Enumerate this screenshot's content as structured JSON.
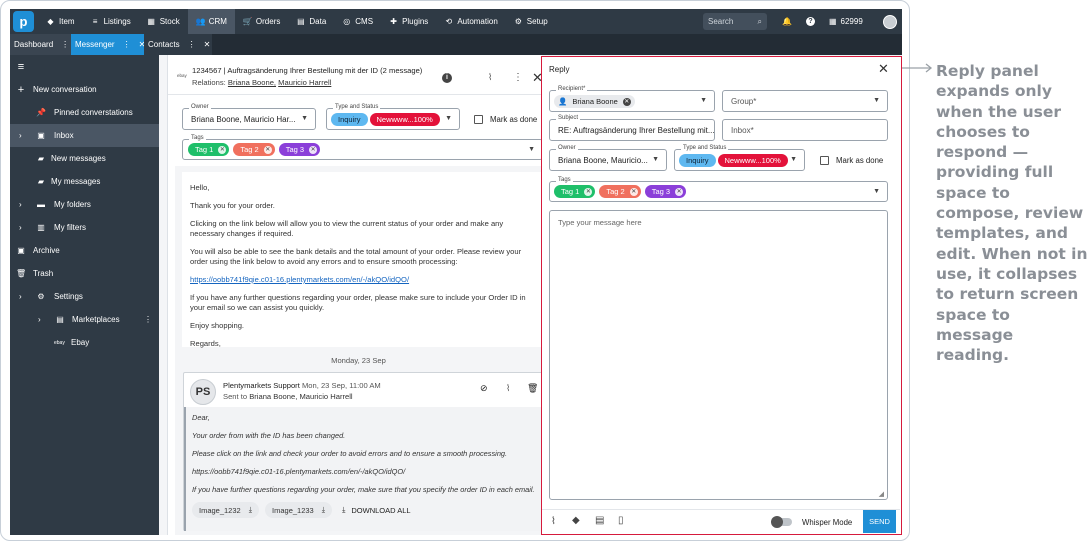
{
  "topbar": {
    "nav": [
      {
        "label": "Item",
        "icon": "tag-icon"
      },
      {
        "label": "Listings",
        "icon": "list-icon"
      },
      {
        "label": "Stock",
        "icon": "stock-icon"
      },
      {
        "label": "CRM",
        "icon": "people-icon"
      },
      {
        "label": "Orders",
        "icon": "cart-icon"
      },
      {
        "label": "Data",
        "icon": "data-icon"
      },
      {
        "label": "CMS",
        "icon": "cms-icon"
      },
      {
        "label": "Plugins",
        "icon": "puzzle-icon"
      },
      {
        "label": "Automation",
        "icon": "automation-icon"
      },
      {
        "label": "Setup",
        "icon": "gear-icon"
      }
    ],
    "search_placeholder": "Search",
    "account_id": "62999"
  },
  "tabs": {
    "dashboard": "Dashboard",
    "messenger": "Messenger",
    "contacts": "Contacts"
  },
  "sidebar": {
    "items": [
      {
        "label": "New conversation"
      },
      {
        "label": "Pinned converstations"
      },
      {
        "label": "Inbox"
      },
      {
        "label": "New messages"
      },
      {
        "label": "My messages"
      },
      {
        "label": "My folders"
      },
      {
        "label": "My filters"
      },
      {
        "label": "Archive"
      },
      {
        "label": "Trash"
      },
      {
        "label": "Settings"
      },
      {
        "label": "Marketplaces"
      },
      {
        "label": "Ebay"
      }
    ]
  },
  "message": {
    "title": "1234567 | Auftragsänderung Ihrer Bestellung mit der ID (2 message)",
    "relations_label": "Relations:",
    "relation1": "Briana Boone,",
    "relation2": "Mauricio Harrell",
    "owner_label": "Owner",
    "owner_value": "Briana Boone, Mauricio Har...",
    "type_label": "Type and Status",
    "type_inquiry": "Inquiry",
    "type_status": "Newwww...100%",
    "mark_done": "Mark as done",
    "tags_label": "Tags",
    "tags": [
      "Tag 1",
      "Tag 2",
      "Tag 3"
    ],
    "body": [
      "Hello,",
      "Thank you for your order.",
      "Clicking on the link below will allow you to view the current status of your order and make any necessary changes if required.",
      "You will also be able to see the bank details and the total amount of your order. Please review your order using the link below to avoid any errors and to ensure smooth processing:",
      "https://oobb741f9qie.c01-16.plentymarkets.com/en/-/akQO/idQO/",
      "If you have any further questions regarding your order, please make sure to include your Order ID in your email so we can assist you quickly.",
      "Enjoy shopping.",
      "Regards,"
    ],
    "date_divider": "Monday, 23 Sep",
    "reply_card": {
      "initials": "PS",
      "sender": "Plentymarkets Support",
      "datetime": "Mon, 23 Sep, 11:00 AM",
      "sent_to_label": "Sent to",
      "sent_to": "Briana Boone, Mauricio Harrell",
      "body": [
        "Dear,",
        "Your order from with the ID has been changed.",
        "Please click on the link and check your order to avoid errors and to ensure a smooth processing.",
        "https://oobb741f9qie.c01-16.plentymarkets.com/en/-/akQO/idQO/",
        "If you have further questions regarding your order, make sure that you specify the order ID in each email."
      ],
      "attachments": [
        "Image_1232",
        "Image_1233"
      ],
      "download_all": "DOWNLOAD ALL"
    }
  },
  "reply": {
    "title": "Reply",
    "recipient_label": "Recipient*",
    "recipient": "Briana Boone",
    "group_placeholder": "Group*",
    "subject_label": "Subject",
    "subject": "RE: Auftragsänderung Ihrer Bestellung mit...",
    "inbox_placeholder": "Inbox*",
    "owner_label": "Owner",
    "owner_value": "Briana Boone, Mauricio...",
    "type_label": "Type and Status",
    "type_inquiry": "Inquiry",
    "type_status": "Newwww...100%",
    "mark_done": "Mark as done",
    "tags_label": "Tags",
    "tags": [
      "Tag 1",
      "Tag 2",
      "Tag 3"
    ],
    "message_placeholder": "Type your message here",
    "whisper_mode": "Whisper Mode",
    "send": "SEND"
  },
  "annotation": "Reply panel expands only when the user chooses to respond — providing full space to compose, review templates, and edit. When not in use, it collapses to return screen space to message reading.",
  "colors": {
    "accent": "#1f8fd6",
    "topbar": "#2f3a45",
    "tag1": "#1fbf6a",
    "tag2": "#f0705e",
    "tag3": "#8b3fd9",
    "status": "#e3123a",
    "inquiry": "#5eb8f0",
    "reply_border": "#d61a3c",
    "send": "#1f8fd6"
  }
}
